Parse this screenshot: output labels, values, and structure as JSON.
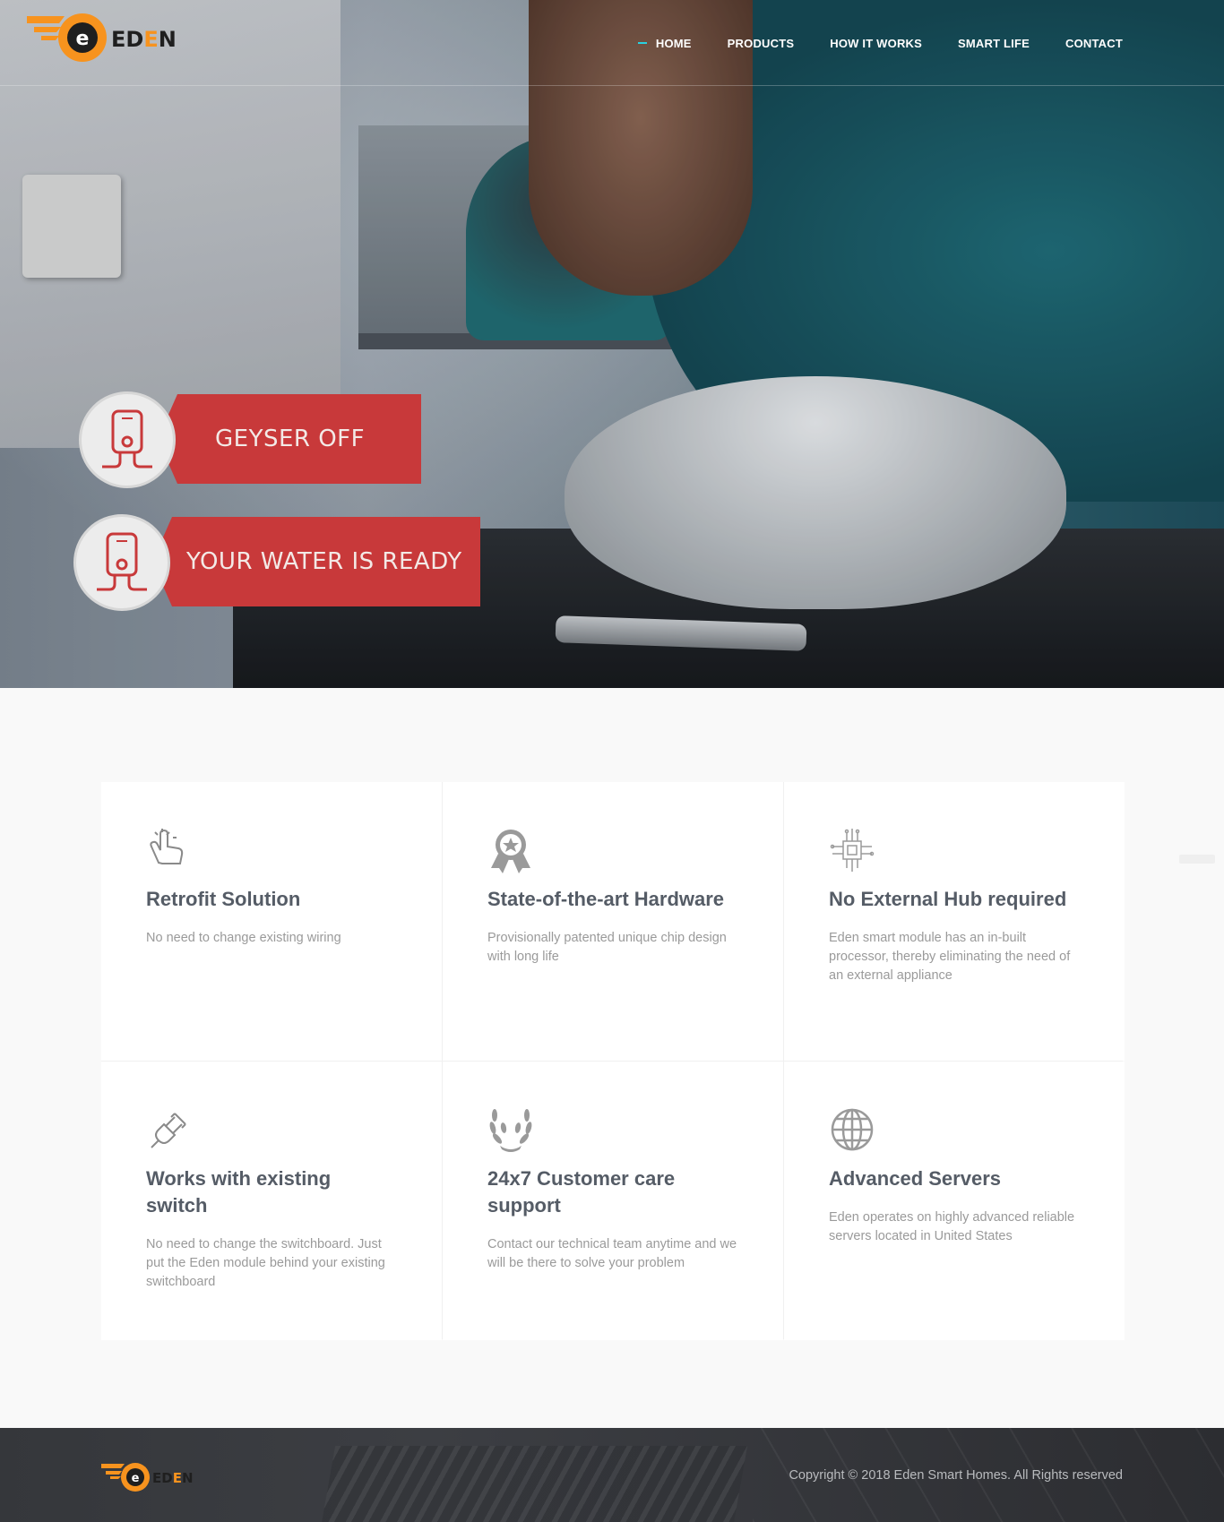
{
  "brand": {
    "name": "EDEN",
    "letter": "e"
  },
  "nav": {
    "items": [
      {
        "label": "HOME",
        "active": true
      },
      {
        "label": "PRODUCTS",
        "active": false
      },
      {
        "label": "HOW IT WORKS",
        "active": false
      },
      {
        "label": "SMART LIFE",
        "active": false
      },
      {
        "label": "CONTACT",
        "active": false
      }
    ]
  },
  "hero": {
    "notifications": [
      {
        "text": "GEYSER OFF",
        "icon": "water-heater-icon"
      },
      {
        "text": "YOUR WATER IS READY",
        "icon": "water-heater-icon"
      }
    ]
  },
  "features": [
    {
      "icon": "tap-hand-icon",
      "title": "Retrofit Solution",
      "desc": "No need to change existing wiring"
    },
    {
      "icon": "award-ribbon-icon",
      "title": "State-of-the-art Hardware",
      "desc": "Provisionally patented unique chip design with long life"
    },
    {
      "icon": "chip-icon",
      "title": "No External Hub required",
      "desc": "Eden smart module has an in-built processor, thereby eliminating the need of an external appliance"
    },
    {
      "icon": "plug-icon",
      "title": "Works with existing switch",
      "desc": "No need to change the switchboard. Just put the Eden module behind your existing switchboard"
    },
    {
      "icon": "laurel-wreath-icon",
      "title": "24x7 Customer care support",
      "desc": "Contact our technical team anytime and we will be there to solve your problem"
    },
    {
      "icon": "globe-icon",
      "title": "Advanced Servers",
      "desc": "Eden operates on highly advanced reliable servers located in United States"
    }
  ],
  "footer": {
    "copyright": "Copyright © 2018 Eden Smart Homes. All Rights reserved"
  },
  "colors": {
    "brand_orange": "#f7931e",
    "notif_red": "#c8393a",
    "accent_cyan": "#29d1e0",
    "heading": "#555c66"
  }
}
